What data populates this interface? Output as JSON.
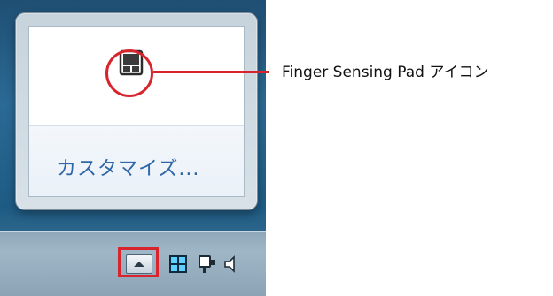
{
  "popup": {
    "customize_label": "カスタマイズ..."
  },
  "callout": {
    "label": "Finger Sensing Pad アイコン"
  },
  "tray": {
    "icons": [
      "finger-sensing-pad-icon",
      "network-grid-icon",
      "power-plug-icon",
      "speaker-icon"
    ]
  },
  "colors": {
    "highlight": "#d7242d",
    "link": "#2f66a8"
  }
}
